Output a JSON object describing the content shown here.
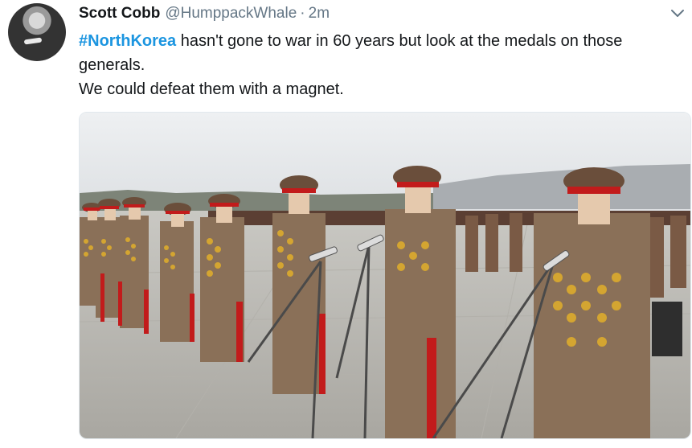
{
  "tweet": {
    "author_name": "Scott Cobb",
    "author_handle": "@HumppackWhale",
    "separator": "·",
    "timestamp": "2m",
    "hashtag": "#NorthKorea",
    "text_line1_rest": " hasn't gone to war in 60 years but look at the medals on those",
    "text_line2": "generals.",
    "text_line3": "We could defeat them with a magnet."
  },
  "icons": {
    "menu": "chevron-down-icon",
    "avatar": "avatar"
  },
  "colors": {
    "hashtag": "#1b95e0",
    "secondary_text": "#657786",
    "uniform": "#8a7058",
    "cap_band": "#c21b1b",
    "medal_gold": "#d4a531"
  }
}
